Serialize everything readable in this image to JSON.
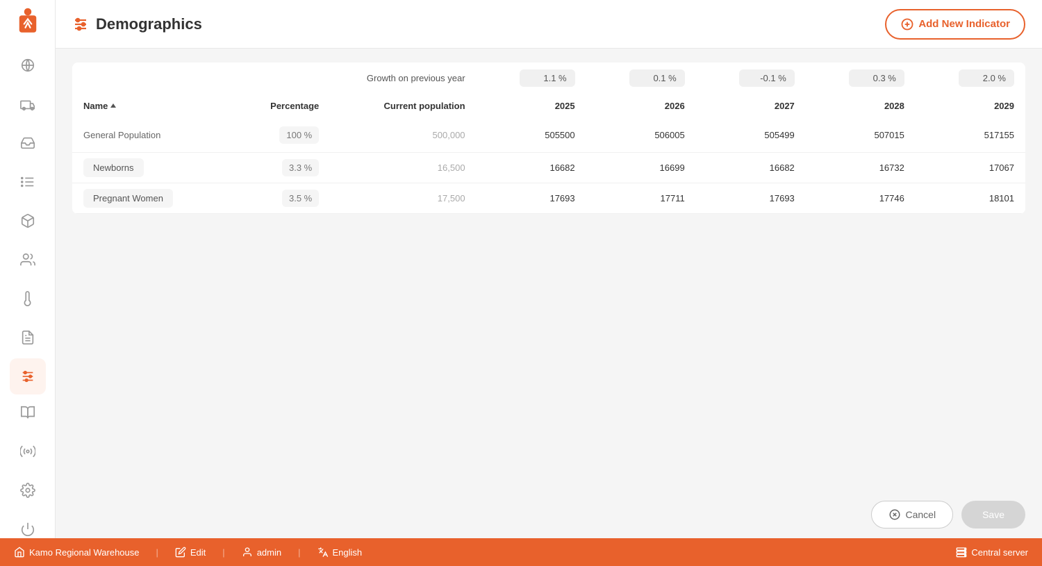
{
  "header": {
    "title": "Demographics",
    "add_button_label": "Add New Indicator"
  },
  "sidebar": {
    "items": [
      {
        "id": "globe",
        "icon": "globe-icon"
      },
      {
        "id": "truck",
        "icon": "truck-icon"
      },
      {
        "id": "inbox",
        "icon": "inbox-icon"
      },
      {
        "id": "list",
        "icon": "list-icon"
      },
      {
        "id": "cube",
        "icon": "cube-icon"
      },
      {
        "id": "people",
        "icon": "people-icon"
      },
      {
        "id": "thermometer",
        "icon": "thermometer-icon"
      },
      {
        "id": "document",
        "icon": "document-icon"
      },
      {
        "id": "sliders",
        "icon": "sliders-icon",
        "active": true
      },
      {
        "id": "book",
        "icon": "book-icon"
      },
      {
        "id": "signal",
        "icon": "signal-icon"
      },
      {
        "id": "settings",
        "icon": "settings-icon"
      },
      {
        "id": "power",
        "icon": "power-icon"
      }
    ]
  },
  "table": {
    "growth_label": "Growth on previous year",
    "growth_values": [
      "1.1  %",
      "0.1  %",
      "-0.1  %",
      "0.3  %",
      "2.0  %"
    ],
    "columns": {
      "name": "Name",
      "percentage": "Percentage",
      "current_population": "Current population",
      "y2025": "2025",
      "y2026": "2026",
      "y2027": "2027",
      "y2028": "2028",
      "y2029": "2029"
    },
    "rows": [
      {
        "name": "General Population",
        "percentage": "100  %",
        "current_population": "500,000",
        "y2025": "505500",
        "y2026": "506005",
        "y2027": "505499",
        "y2028": "507015",
        "y2029": "517155"
      },
      {
        "name": "Newborns",
        "percentage": "3.3  %",
        "current_population": "16,500",
        "y2025": "16682",
        "y2026": "16699",
        "y2027": "16682",
        "y2028": "16732",
        "y2029": "17067"
      },
      {
        "name": "Pregnant Women",
        "percentage": "3.5  %",
        "current_population": "17,500",
        "y2025": "17693",
        "y2026": "17711",
        "y2027": "17693",
        "y2028": "17746",
        "y2029": "18101"
      }
    ]
  },
  "footer": {
    "cancel_label": "Cancel",
    "save_label": "Save"
  },
  "statusbar": {
    "warehouse": "Kamo Regional Warehouse",
    "edit": "Edit",
    "user": "admin",
    "language": "English",
    "server": "Central server"
  }
}
